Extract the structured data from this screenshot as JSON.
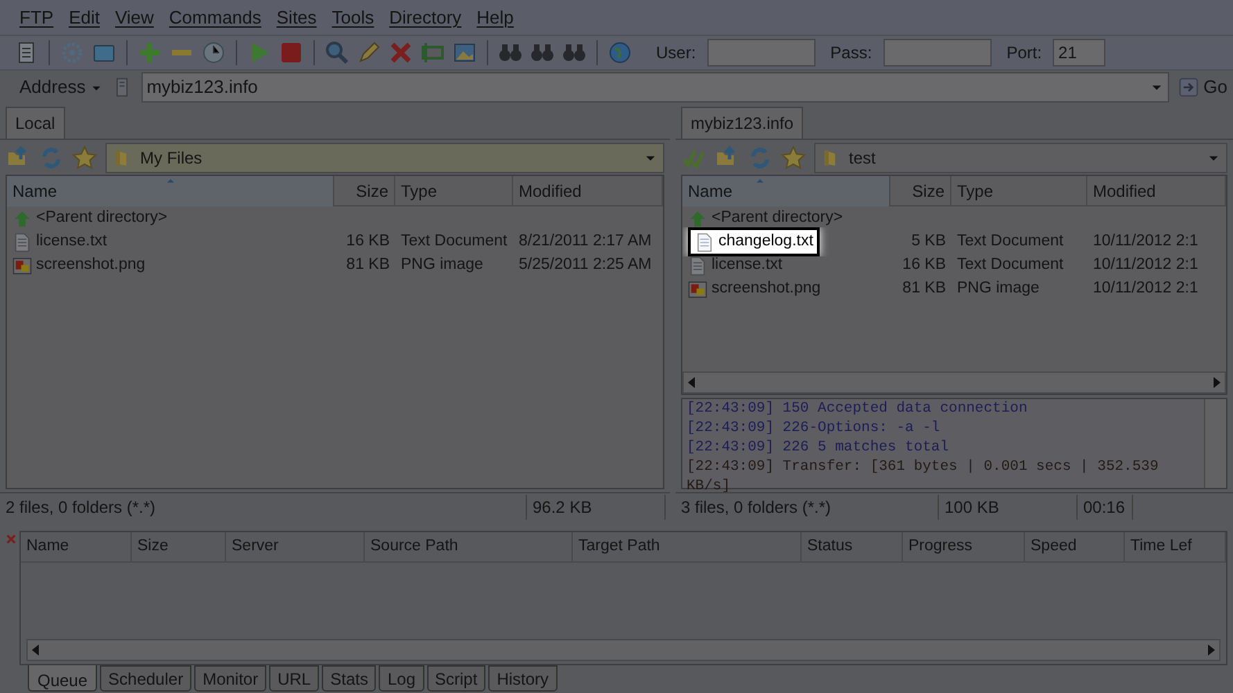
{
  "menu": [
    "FTP",
    "Edit",
    "View",
    "Commands",
    "Sites",
    "Tools",
    "Directory",
    "Help"
  ],
  "login": {
    "user_label": "User:",
    "pass_label": "Pass:",
    "port_label": "Port:",
    "port": "21"
  },
  "address": {
    "label": "Address",
    "value": "mybiz123.info",
    "go": "Go"
  },
  "local": {
    "tab": "Local",
    "path": "My Files",
    "columns": [
      "Name",
      "Size",
      "Type",
      "Modified"
    ],
    "rows": [
      {
        "kind": "parent",
        "name": "<Parent directory>"
      },
      {
        "kind": "text",
        "name": "license.txt",
        "size": "16 KB",
        "type": "Text Document",
        "modified": "8/21/2011 2:17 AM",
        "highlighted": false
      },
      {
        "kind": "image",
        "name": "screenshot.png",
        "size": "81 KB",
        "type": "PNG image",
        "modified": "5/25/2011 2:25 AM",
        "highlighted": false
      }
    ],
    "status": [
      "2 files, 0 folders (*.*)",
      "96.2 KB"
    ]
  },
  "remote": {
    "tab": "mybiz123.info",
    "path": "test",
    "columns": [
      "Name",
      "Size",
      "Type",
      "Modified"
    ],
    "rows": [
      {
        "kind": "parent",
        "name": "<Parent directory>"
      },
      {
        "kind": "text",
        "name": "changelog.txt",
        "size": "5 KB",
        "type": "Text Document",
        "modified": "10/11/2012 2:1",
        "highlighted": true
      },
      {
        "kind": "text",
        "name": "license.txt",
        "size": "16 KB",
        "type": "Text Document",
        "modified": "10/11/2012 2:1",
        "highlighted": false
      },
      {
        "kind": "image",
        "name": "screenshot.png",
        "size": "81 KB",
        "type": "PNG image",
        "modified": "10/11/2012 2:1",
        "highlighted": false
      }
    ],
    "log": [
      "[22:43:09] 150 Accepted data connection",
      "[22:43:09] 226-Options: -a -l",
      "[22:43:09] 226 5 matches total",
      "[22:43:09] Transfer: [361 bytes | 0.001 secs | 352.539 KB/s]"
    ],
    "status": [
      "3 files, 0 folders (*.*)",
      "100 KB",
      "00:16"
    ]
  },
  "queue": {
    "columns": [
      "Name",
      "Size",
      "Server",
      "Source Path",
      "Target Path",
      "Status",
      "Progress",
      "Speed",
      "Time Lef"
    ]
  },
  "bottom_tabs": [
    {
      "label": "Queue",
      "selected": true
    },
    {
      "label": "Scheduler",
      "selected": false
    },
    {
      "label": "Monitor",
      "selected": false
    },
    {
      "label": "URL",
      "selected": false
    },
    {
      "label": "Stats",
      "selected": false
    },
    {
      "label": "Log",
      "selected": false
    },
    {
      "label": "Script",
      "selected": false
    },
    {
      "label": "History",
      "selected": false
    }
  ]
}
